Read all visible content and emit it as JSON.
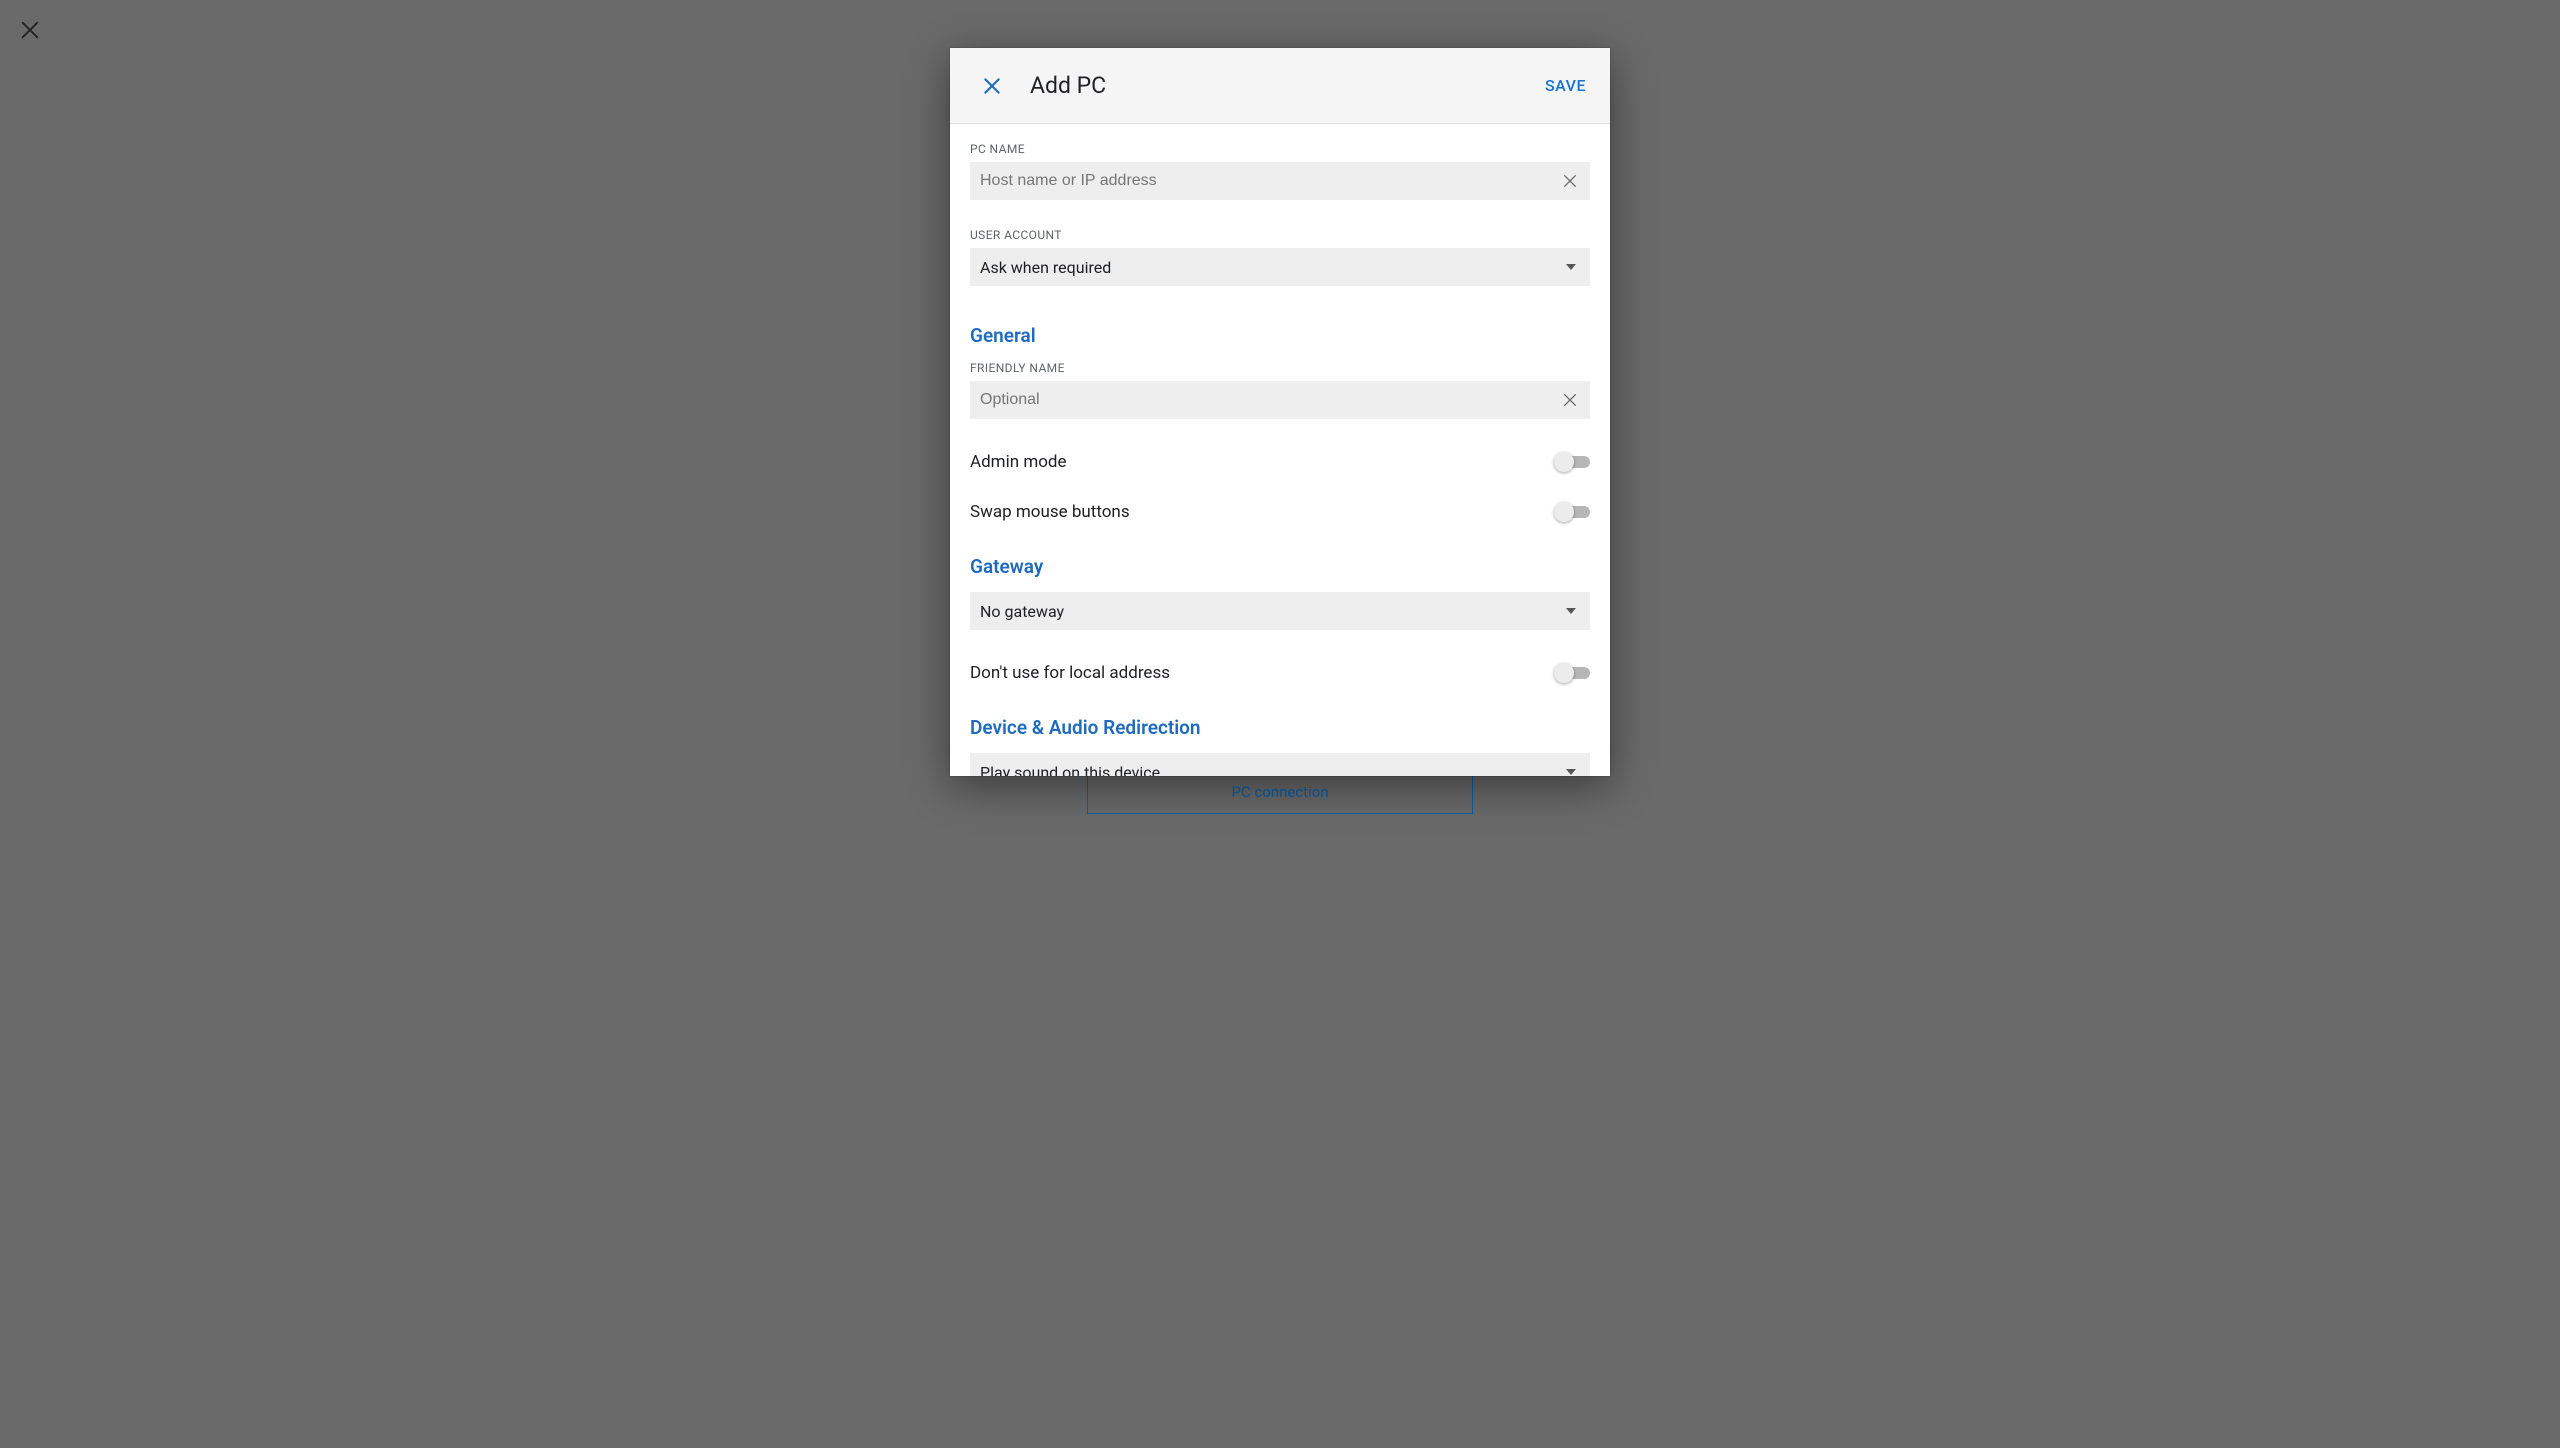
{
  "backdrop": {
    "underlay_button": "PC connection"
  },
  "dialog": {
    "title": "Add PC",
    "save": "SAVE",
    "pc_name": {
      "label": "PC NAME",
      "placeholder": "Host name or IP address",
      "value": ""
    },
    "user_account": {
      "label": "USER ACCOUNT",
      "value": "Ask when required"
    },
    "sections": {
      "general": {
        "heading": "General",
        "friendly_name": {
          "label": "FRIENDLY NAME",
          "placeholder": "Optional",
          "value": ""
        },
        "admin_mode": {
          "label": "Admin mode",
          "value": false
        },
        "swap_mouse": {
          "label": "Swap mouse buttons",
          "value": false
        }
      },
      "gateway": {
        "heading": "Gateway",
        "value": "No gateway",
        "dont_use_local": {
          "label": "Don't use for local address",
          "value": false
        }
      },
      "redirection": {
        "heading": "Device & Audio Redirection",
        "sound": {
          "value": "Play sound on this device"
        }
      }
    }
  }
}
